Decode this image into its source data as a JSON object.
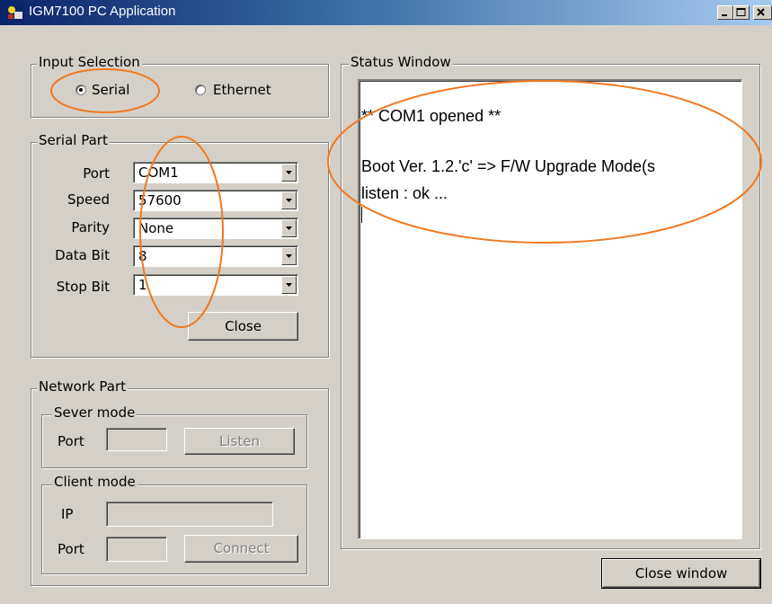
{
  "window": {
    "title": "IGM7100 PC Application",
    "buttons": {
      "minimize": "minimize",
      "maximize": "maximize",
      "close": "close"
    }
  },
  "input_selection": {
    "label": "Input Selection",
    "options": [
      {
        "label": "Serial",
        "selected": true
      },
      {
        "label": "Ethernet",
        "selected": false
      }
    ]
  },
  "serial_part": {
    "label": "Serial Part",
    "fields": [
      {
        "label": "Port",
        "value": "COM1"
      },
      {
        "label": "Speed",
        "value": "57600"
      },
      {
        "label": "Parity",
        "value": "None"
      },
      {
        "label": "Data Bit",
        "value": "8"
      },
      {
        "label": "Stop Bit",
        "value": "1"
      }
    ],
    "close_button": "Close"
  },
  "network_part": {
    "label": "Network Part",
    "server_mode": {
      "label": "Sever mode",
      "port_label": "Port",
      "port_value": "",
      "listen_button": "Listen"
    },
    "client_mode": {
      "label": "Client mode",
      "ip_label": "IP",
      "ip_value": "",
      "port_label": "Port",
      "port_value": "",
      "connect_button": "Connect"
    }
  },
  "status_window": {
    "label": "Status Window",
    "lines": [
      " ** COM1 opened **",
      "",
      "Boot Ver. 1.2.'c' => F/W Upgrade Mode(s",
      "listen : ok ..."
    ]
  },
  "close_window_button": "Close window",
  "colors": {
    "face": "#d4d0c8",
    "title_start": "#0a246a",
    "title_end": "#a6caf0",
    "annotation": "#f07820"
  }
}
